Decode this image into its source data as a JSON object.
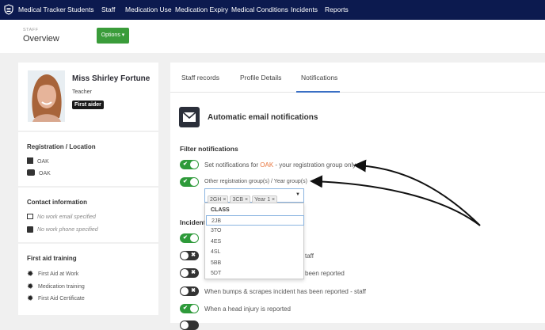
{
  "nav": {
    "brand": "Medical Tracker",
    "items": [
      "Students",
      "Staff",
      "Medication Use",
      "Medication Expiry",
      "Medical Conditions",
      "Incidents",
      "Reports"
    ]
  },
  "header": {
    "breadcrumb": "STAFF",
    "title": "Overview",
    "options_label": "Options"
  },
  "profile": {
    "name": "Miss Shirley Fortune",
    "role": "Teacher",
    "badge": "First aider"
  },
  "registration": {
    "title": "Registration / Location",
    "registration": "OAK",
    "location": "OAK"
  },
  "contact": {
    "title": "Contact information",
    "email": "No work email specified",
    "phone": "No work phone specified"
  },
  "training": {
    "title": "First aid training",
    "items": [
      "First Aid at Work",
      "Medication training",
      "First Aid Certificate"
    ]
  },
  "tabs": [
    "Staff records",
    "Profile Details",
    "Notifications"
  ],
  "notifications": {
    "title": "Automatic email notifications",
    "filter_title": "Filter notifications",
    "own_group_prefix": "Set notifications for ",
    "own_group_code": "OAK",
    "own_group_suffix": " - your registration group only",
    "other_groups_label": "Other registration group(s) / Year group(s)",
    "selected": [
      "2GH",
      "3CB",
      "Year 1"
    ],
    "dropdown_group": "CLASS",
    "dropdown_options": [
      "2JB",
      "3TO",
      "4ES",
      "4SL",
      "5BB",
      "5DT"
    ],
    "incidents_title": "Incident",
    "incident_fragments": [
      "taff",
      "been reported"
    ],
    "incident_items": [
      "When bumps & scrapes incident has been reported - staff",
      "When a head injury is reported"
    ],
    "toggles": [
      true,
      true,
      true,
      false,
      false,
      false,
      true
    ]
  },
  "colors": {
    "nav": "#0c1a4f",
    "accent_green": "#2e9a3a",
    "accent_orange": "#e8743b",
    "tab_active": "#3a6fc4"
  }
}
